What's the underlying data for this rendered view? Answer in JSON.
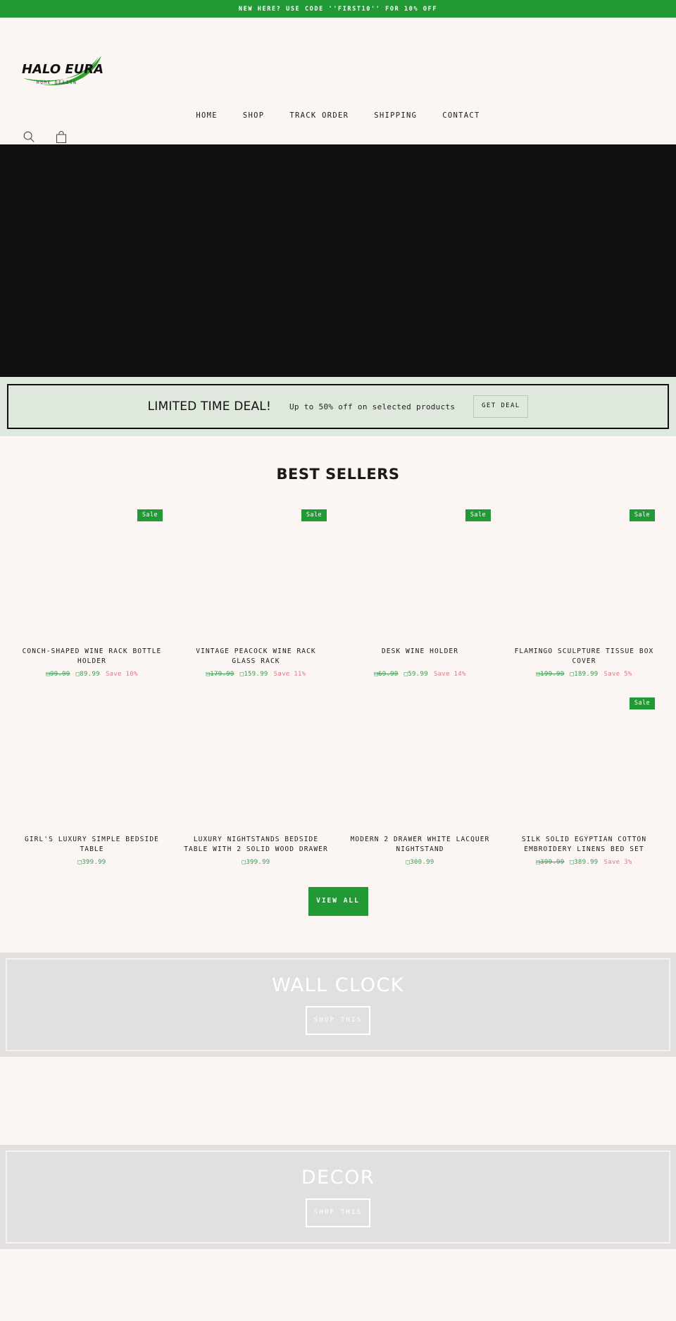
{
  "announcement": {
    "text": "NEW HERE? USE CODE ''FIRST10'' FOR 10% OFF",
    "bg_color": "#219a36",
    "text_color": "#ffffff"
  },
  "header": {
    "logo_main": "HALO EURA",
    "logo_sub": "HOME DESIGN",
    "logo_accent_color": "#2ba02b",
    "nav": [
      {
        "label": "HOME"
      },
      {
        "label": "SHOP"
      },
      {
        "label": "TRACK ORDER"
      },
      {
        "label": "SHIPPING"
      },
      {
        "label": "CONTACT"
      }
    ],
    "utilities": [
      {
        "icon": "search-icon",
        "label": "Search"
      },
      {
        "icon": "shopping-bag-icon",
        "label": "Cart"
      }
    ]
  },
  "hero": {
    "background_color": "#101010"
  },
  "deal": {
    "title": "LIMITED TIME DEAL!",
    "subtitle": "Up to 50% off on selected products",
    "button_label": "GET DEAL",
    "bg_color": "#dfe8dd"
  },
  "best_sellers": {
    "title": "BEST SELLERS",
    "view_all_label": "VIEW ALL",
    "badge_label": "Sale",
    "save_prefix": "Save",
    "currency_symbol": "₨",
    "products": [
      {
        "title": "CONCH-SHAPED WINE RACK BOTTLE HOLDER",
        "on_sale": true,
        "price_old": "99.99",
        "price_new": "89.99",
        "save": "Save 10%"
      },
      {
        "title": "VINTAGE PEACOCK WINE RACK GLASS RACK",
        "on_sale": true,
        "price_old": "179.99",
        "price_new": "159.99",
        "save": "Save 11%"
      },
      {
        "title": "DESK WINE HOLDER",
        "on_sale": true,
        "price_old": "69.99",
        "price_new": "59.99",
        "save": "Save 14%"
      },
      {
        "title": "FLAMINGO SCULPTURE TISSUE BOX COVER",
        "on_sale": true,
        "price_old": "199.99",
        "price_new": "189.99",
        "save": "Save 5%"
      },
      {
        "title": "GIRL'S LUXURY SIMPLE BEDSIDE TABLE",
        "on_sale": false,
        "price_old": "",
        "price_new": "399.99",
        "save": ""
      },
      {
        "title": "LUXURY NIGHTSTANDS BEDSIDE TABLE WITH 2 SOLID WOOD DRAWER",
        "on_sale": false,
        "price_old": "",
        "price_new": "399.99",
        "save": ""
      },
      {
        "title": "MODERN 2 DRAWER WHITE LACQUER NIGHTSTAND",
        "on_sale": false,
        "price_old": "",
        "price_new": "300.99",
        "save": ""
      },
      {
        "title": "SILK SOLID EGYPTIAN COTTON EMBROIDERY LINENS BED SET",
        "on_sale": true,
        "price_old": "399.99",
        "price_new": "389.99",
        "save": "Save 3%"
      }
    ]
  },
  "collections": [
    {
      "title": "WALL CLOCK",
      "button_label": "SHOP THIS",
      "bg_color": "#e2e0df"
    },
    {
      "title": "DECOR",
      "button_label": "SHOP THIS",
      "bg_color": "#e2e0df"
    }
  ]
}
